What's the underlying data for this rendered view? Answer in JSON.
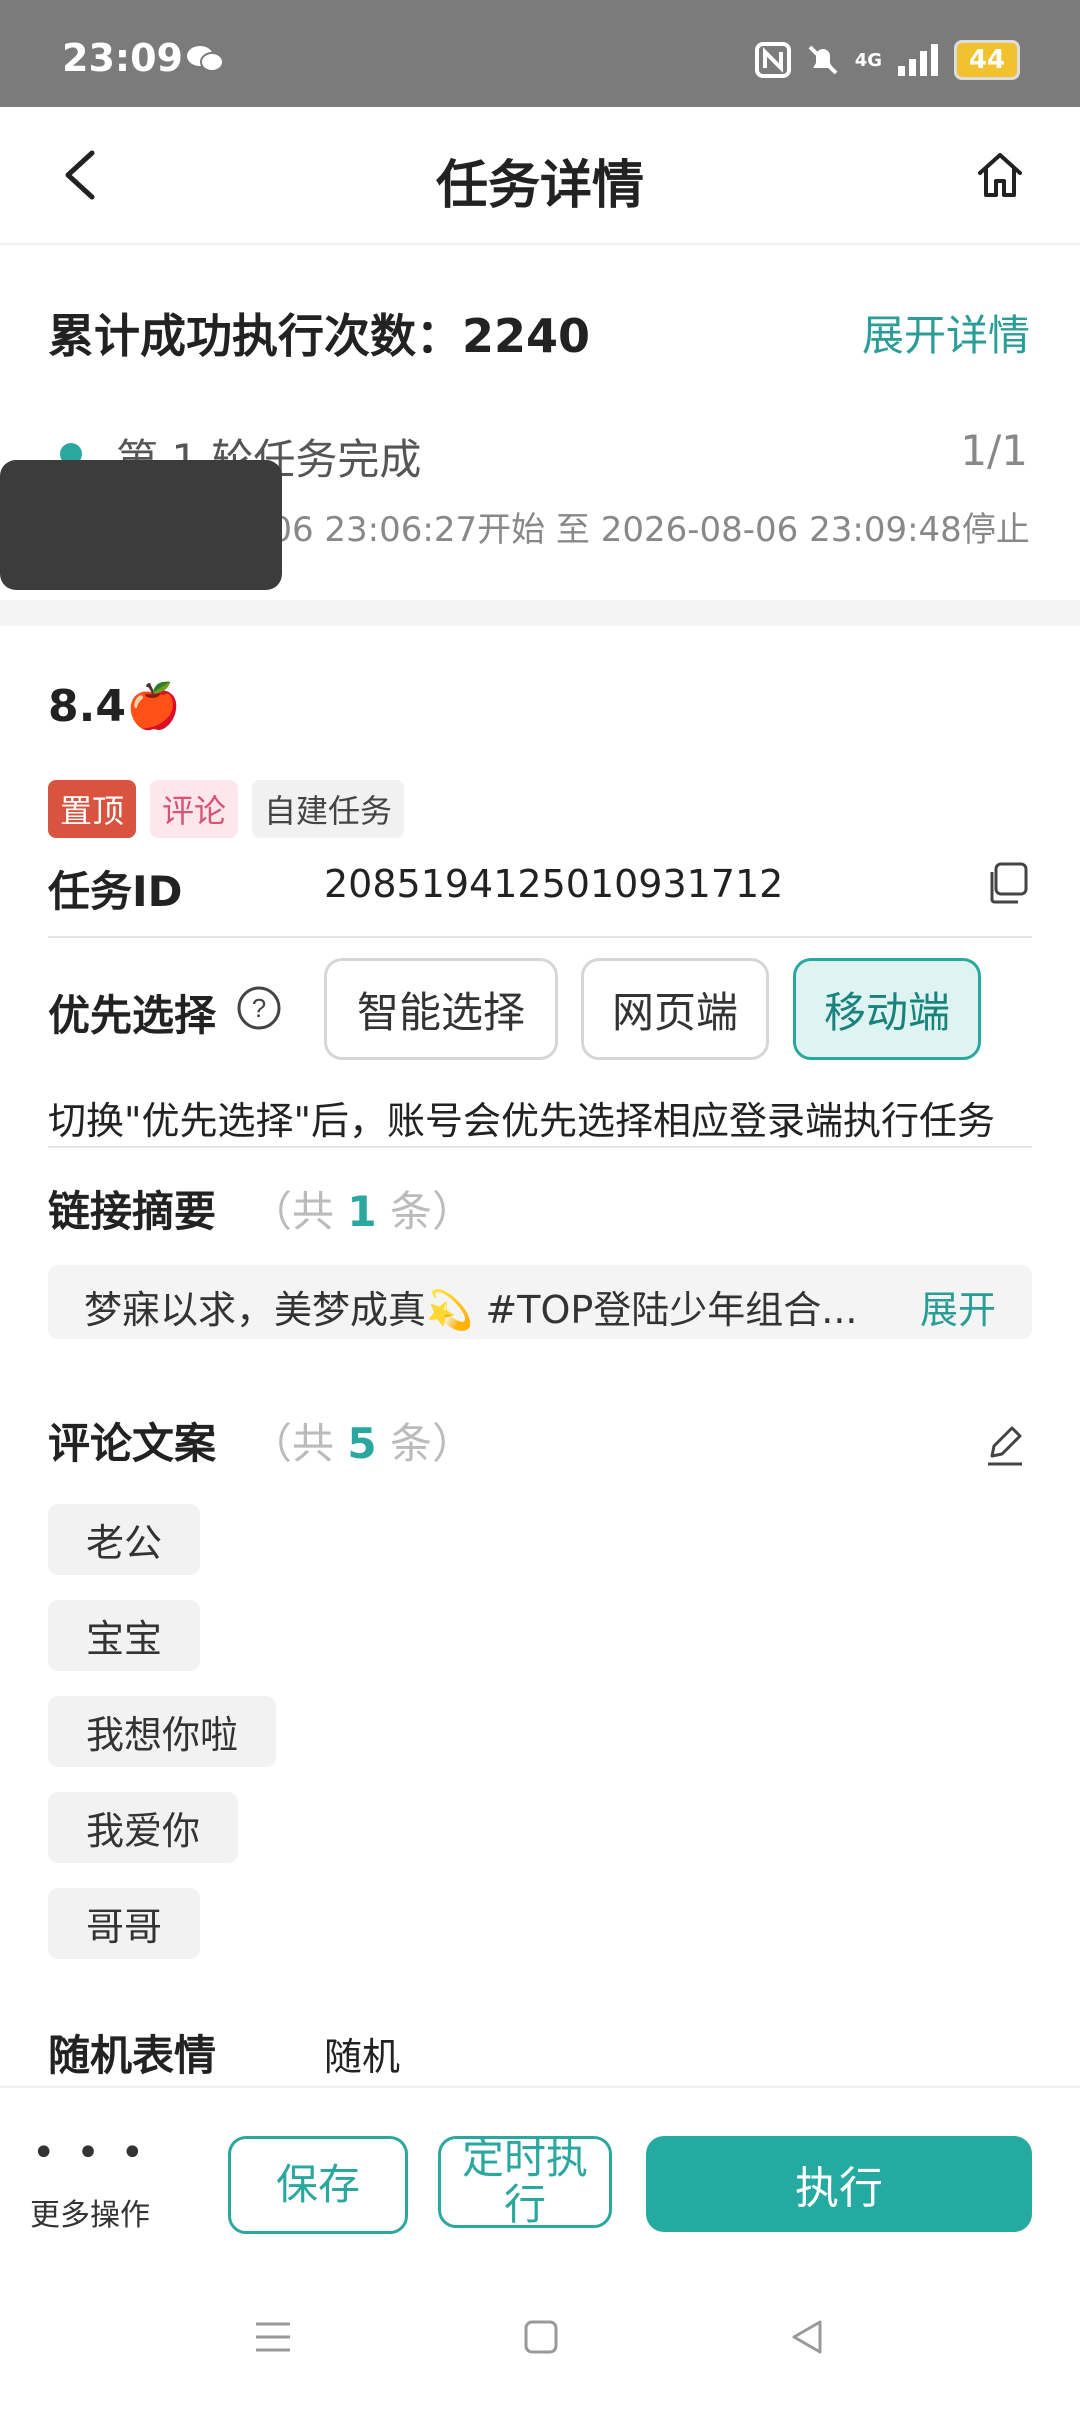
{
  "status": {
    "time": "23:09",
    "battery": "44",
    "network": "4G"
  },
  "header": {
    "title": "任务详情"
  },
  "summary": {
    "count_label": "累计成功执行次数：2240",
    "expand_label": "展开详情"
  },
  "round": {
    "title": "第 1 轮任务完成",
    "count": "1/1",
    "time_range": "2026-08-06 23:06:27开始 至 2026-08-06 23:09:48停止"
  },
  "task": {
    "name": "8.4🍎",
    "tags": [
      "置顶",
      "评论",
      "自建任务"
    ],
    "id_label": "任务ID",
    "id_value": "2085194125010931712"
  },
  "priority": {
    "label": "优先选择",
    "options": [
      "智能选择",
      "网页端",
      "移动端"
    ],
    "selected": "移动端",
    "hint": "切换\"优先选择\"后，账号会优先选择相应登录端执行任务"
  },
  "links": {
    "label": "链接摘要",
    "count_prefix": "（共",
    "count": "1",
    "count_suffix": "条）",
    "summary_text": "梦寐以求，美梦成真💫 #TOP登陆少年组合...",
    "expand_label": "展开"
  },
  "comments": {
    "label": "评论文案",
    "count_prefix": "（共",
    "count": "5",
    "count_suffix": "条）",
    "items": [
      "老公",
      "宝宝",
      "我想你啦",
      "我爱你",
      "哥哥"
    ]
  },
  "emoji": {
    "label": "随机表情",
    "value": "随机"
  },
  "actions": {
    "more_label": "更多操作",
    "more_dots": "• • •",
    "save_label": "保存",
    "schedule_label": "定时执行",
    "execute_label": "执行"
  },
  "colors": {
    "accent": "#2aa8a0",
    "pin_tag": "#d9533f",
    "comment_tag": "#d65474"
  }
}
